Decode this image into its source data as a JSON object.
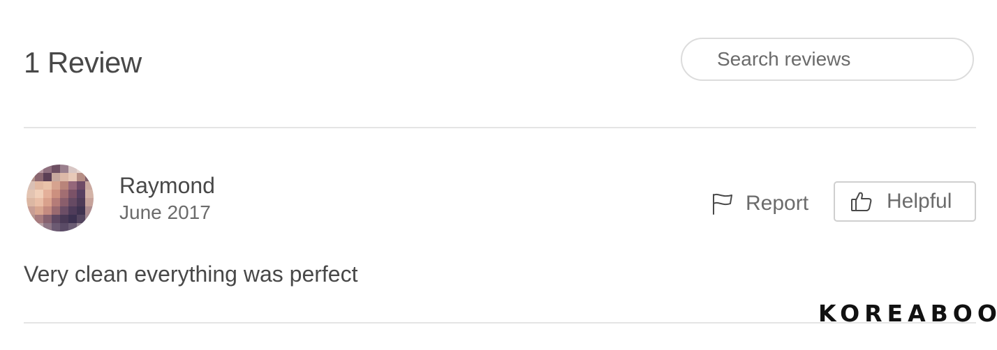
{
  "header": {
    "title": "1 Review"
  },
  "search": {
    "placeholder": "Search reviews",
    "icon": "none"
  },
  "review": {
    "reviewer_name": "Raymond",
    "date": "June 2017",
    "text": "Very clean everything was perfect",
    "avatar_icon": "pixelated-avatar"
  },
  "actions": {
    "report_label": "Report",
    "report_icon": "flag-icon",
    "helpful_label": "Helpful",
    "helpful_icon": "thumbs-up-icon"
  },
  "watermark": {
    "text": "KOREABOO"
  },
  "colors": {
    "text_primary": "#484848",
    "text_secondary": "#6b6b6b",
    "border": "#dcdcdc",
    "divider": "#e4e4e4"
  }
}
